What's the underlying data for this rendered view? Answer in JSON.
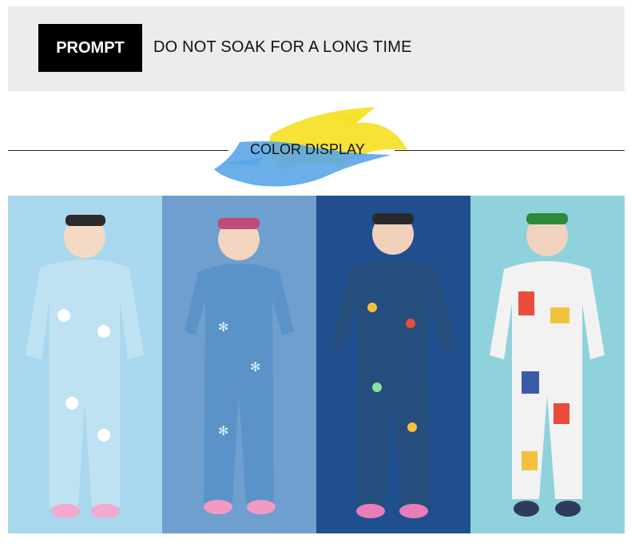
{
  "prompt": {
    "tag_label": "PROMPT",
    "text": "DO NOT SOAK FOR A LONG TIME"
  },
  "section": {
    "title": "COLOR DISPLAY"
  },
  "colors": {
    "prompt_bar_bg": "#ececec",
    "brush_yellow": "#f6e22a",
    "brush_blue": "#5aa6e8"
  },
  "panels": [
    {
      "name": "polar-bear-print",
      "background": "#a9d7ee",
      "suit": "#bfe2f3",
      "pattern": "#ffffff",
      "boots": "#f2a9cf"
    },
    {
      "name": "snowflake-print",
      "background": "#6f9fcf",
      "suit": "#5b93c9",
      "pattern": "#e8f4ff",
      "boots": "#f09ac4"
    },
    {
      "name": "confetti-print",
      "background": "#1f4f8f",
      "suit": "#264e7c",
      "pattern": "#f3c23d",
      "boots": "#e97db7"
    },
    {
      "name": "geometric-print",
      "background": "#8fd2dc",
      "suit": "#f2f2f2",
      "pattern": "#e94d3a",
      "boots": "#2f3b5c"
    }
  ]
}
